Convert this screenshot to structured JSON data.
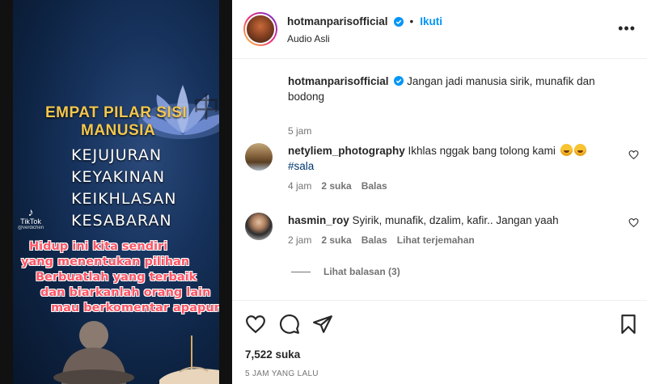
{
  "media": {
    "heading_line1": "EMPAT PILAR SISI",
    "heading_line2": "MANUSIA",
    "pillars": [
      "KEJUJURAN",
      "KEYAKINAN",
      "KEIKHLASAN",
      "KESABARAN"
    ],
    "watermark_brand": "TikTok",
    "watermark_user": "@verdichen",
    "quote_lines": [
      "Hidup ini kita sendiri",
      "yang menentukan pilihan",
      "Berbuatlah yang terbaik",
      "dan biarkanlah orang lain",
      "mau berkomentar apapun"
    ]
  },
  "header": {
    "username": "hotmanparisofficial",
    "follow_label": "Ikuti",
    "subtitle": "Audio Asli",
    "more_icon": "more-options-icon"
  },
  "caption": {
    "username": "hotmanparisofficial",
    "text": "Jangan jadi manusia sirik, munafik dan bodong",
    "time": "5 jam"
  },
  "comments": [
    {
      "username": "netyliem_photography",
      "text": "Ikhlas nggak bang tolong kami",
      "hashtag": "#sala",
      "time": "4 jam",
      "likes": "2 suka",
      "reply_label": "Balas"
    },
    {
      "username": "hasmin_roy",
      "text": "Syirik, munafik, dzalim, kafir.. Jangan yaah",
      "time": "2 jam",
      "likes": "2 suka",
      "reply_label": "Balas",
      "translate_label": "Lihat terjemahan"
    }
  ],
  "replies_label": "Lihat balasan (3)",
  "footer": {
    "likes": "7,522 suka",
    "time_ago": "5 JAM YANG LALU"
  },
  "colors": {
    "accent": "#0095f6",
    "text": "#262626",
    "muted": "#737373",
    "quote_red": "#ff5566",
    "heading_gold": "#f3c74e"
  }
}
